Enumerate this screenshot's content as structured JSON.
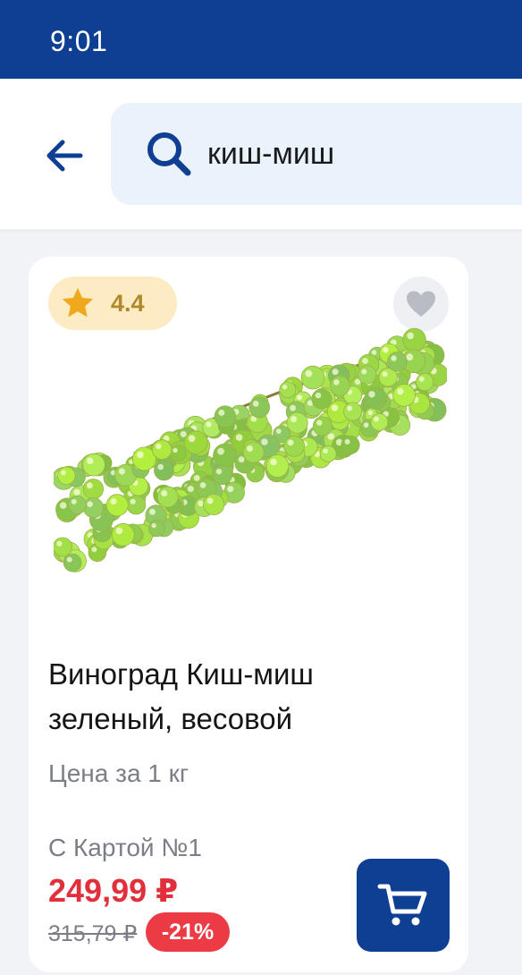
{
  "status_bar": {
    "time": "9:01"
  },
  "search": {
    "query": "киш-миш"
  },
  "product": {
    "rating": "4.4",
    "title": "Виноград Киш-миш зеленый, весовой",
    "price_unit": "Цена за 1 кг",
    "card_label": "С Картой №1",
    "price": "249,99 ₽",
    "old_price": "315,79 ₽",
    "discount": "-21%"
  },
  "icons": {
    "back": "arrow-left-icon",
    "search": "search-icon",
    "rating": "star-icon",
    "favorite": "heart-icon",
    "cart": "cart-icon"
  },
  "colors": {
    "brand": "#0e3f93",
    "price": "#e1303c",
    "discount": "#ec3b44",
    "rating_badge": "#fcebc3",
    "star": "#f0a81c",
    "search_bg": "#eaf2fc"
  }
}
